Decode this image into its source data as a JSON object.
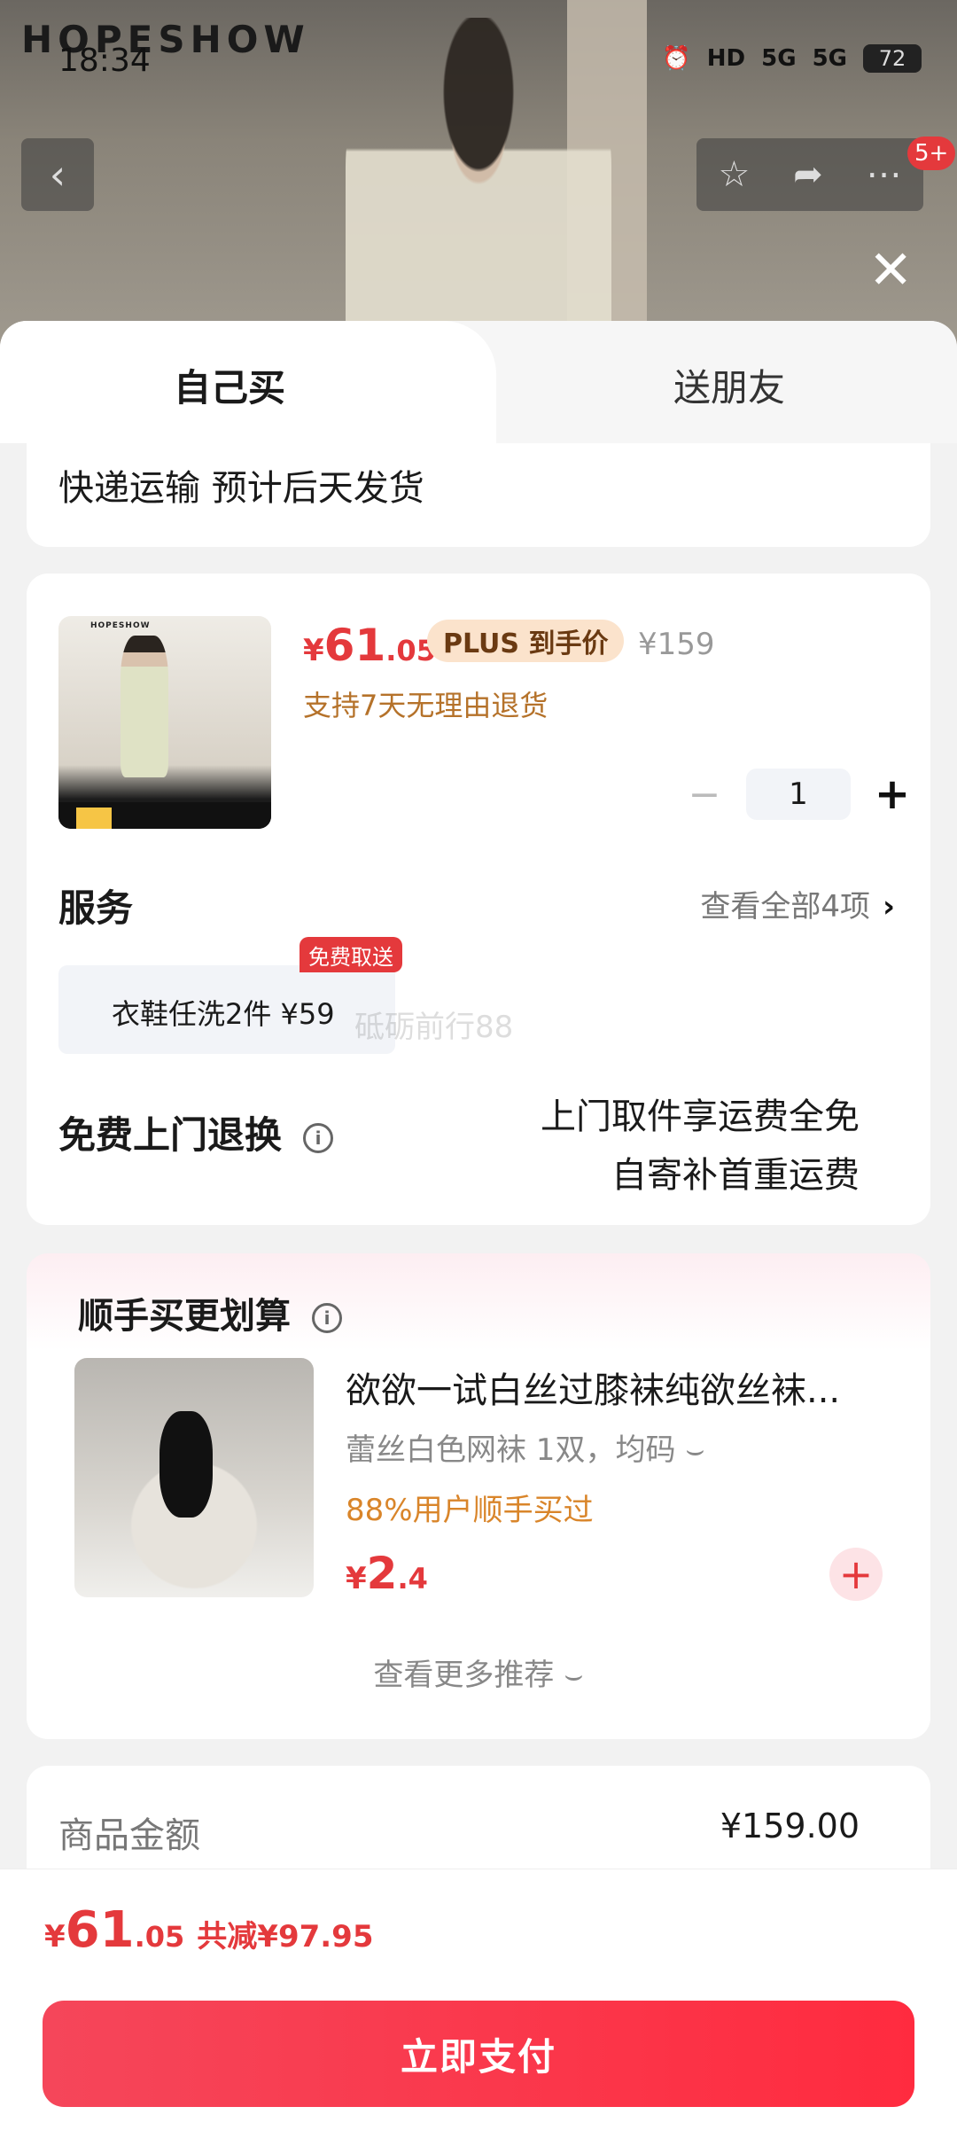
{
  "status_bar": {
    "time": "18:34",
    "battery": "72",
    "hd": "HD",
    "net1": "5G",
    "net2": "5G"
  },
  "hero": {
    "brand": "HOPESHOW",
    "notification_badge": "5+"
  },
  "tabs": [
    {
      "label": "自己买"
    },
    {
      "label": "送朋友"
    }
  ],
  "shipping": {
    "text": "快递运输 预计后天发货"
  },
  "product": {
    "thumb_brand": "HOPESHOW",
    "price_symbol": "¥",
    "price_int": "61",
    "price_dec": ".05",
    "plus_tag": "PLUS 到手价",
    "original_price": "¥159",
    "return_note": "支持7天无理由退货",
    "quantity": "1"
  },
  "services": {
    "title": "服务",
    "view_all": "查看全部4项",
    "chip_text": "衣鞋任洗2件  ¥59",
    "chip_badge": "免费取送",
    "watermark": "砥砺前行88",
    "free_title": "免费上门退换",
    "free_line1": "上门取件享运费全免",
    "free_line2": "自寄补首重运费"
  },
  "recommend": {
    "title": "顺手买更划算",
    "item_name": "欲欲一试白丝过膝袜纯欲丝袜...",
    "item_spec": "蕾丝白色网袜 1双，均码 ⌣",
    "item_social": "88%用户顺手买过",
    "price_symbol": "¥",
    "price_int": "2",
    "price_dec": ".4",
    "more": "查看更多推荐 ⌣"
  },
  "summary": {
    "label": "商品金额",
    "value": "¥159.00"
  },
  "footer": {
    "price_symbol": "¥",
    "price_int": "61",
    "price_dec": ".05",
    "saving": "共减¥97.95",
    "pay_label": "立即支付"
  },
  "colors": {
    "accent": "#e4393c",
    "plus_tag_bg": "#fbe3cc",
    "note": "#b5722a",
    "social": "#d9852a"
  }
}
